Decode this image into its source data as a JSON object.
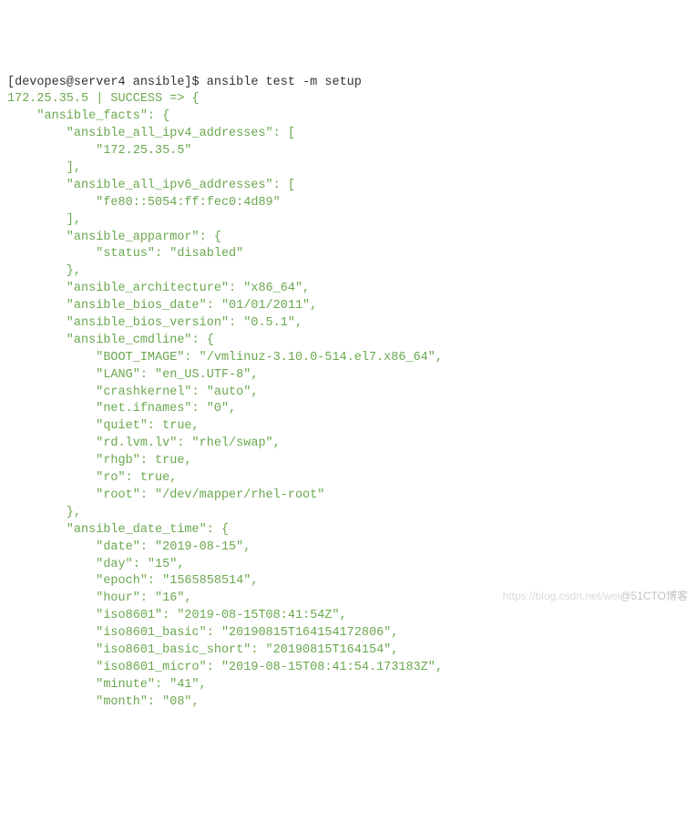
{
  "prompt": "[devopes@server4 ansible]$ ",
  "command": "ansible test -m setup",
  "watermark_faint": "https://blog.csdn.net/wei",
  "watermark": "@51CTO博客",
  "output": {
    "host_line": "172.25.35.5 | SUCCESS => {",
    "facts_open": "    \"ansible_facts\": {",
    "ipv4_open": "        \"ansible_all_ipv4_addresses\": [",
    "ipv4_val": "            \"172.25.35.5\"",
    "ipv4_close": "        ],",
    "ipv6_open": "        \"ansible_all_ipv6_addresses\": [",
    "ipv6_val": "            \"fe80::5054:ff:fec0:4d89\"",
    "ipv6_close": "        ],",
    "apparmor_open": "        \"ansible_apparmor\": {",
    "apparmor_status": "            \"status\": \"disabled\"",
    "apparmor_close": "        },",
    "arch": "        \"ansible_architecture\": \"x86_64\",",
    "bios_date": "        \"ansible_bios_date\": \"01/01/2011\",",
    "bios_ver": "        \"ansible_bios_version\": \"0.5.1\",",
    "cmdline_open": "        \"ansible_cmdline\": {",
    "cmd_boot": "            \"BOOT_IMAGE\": \"/vmlinuz-3.10.0-514.el7.x86_64\",",
    "cmd_lang": "            \"LANG\": \"en_US.UTF-8\",",
    "cmd_crash": "            \"crashkernel\": \"auto\",",
    "cmd_ifnames": "            \"net.ifnames\": \"0\",",
    "cmd_quiet": "            \"quiet\": true,",
    "cmd_lvm": "            \"rd.lvm.lv\": \"rhel/swap\",",
    "cmd_rhgb": "            \"rhgb\": true,",
    "cmd_ro": "            \"ro\": true,",
    "cmd_root": "            \"root\": \"/dev/mapper/rhel-root\"",
    "cmdline_close": "        },",
    "dt_open": "        \"ansible_date_time\": {",
    "dt_date": "            \"date\": \"2019-08-15\",",
    "dt_day": "            \"day\": \"15\",",
    "dt_epoch": "            \"epoch\": \"1565858514\",",
    "dt_hour": "            \"hour\": \"16\",",
    "dt_iso": "            \"iso8601\": \"2019-08-15T08:41:54Z\",",
    "dt_iso_b": "            \"iso8601_basic\": \"20190815T164154172806\",",
    "dt_iso_bs": "            \"iso8601_basic_short\": \"20190815T164154\",",
    "dt_iso_m": "            \"iso8601_micro\": \"2019-08-15T08:41:54.173183Z\",",
    "dt_minute": "            \"minute\": \"41\",",
    "dt_month": "            \"month\": \"08\","
  }
}
